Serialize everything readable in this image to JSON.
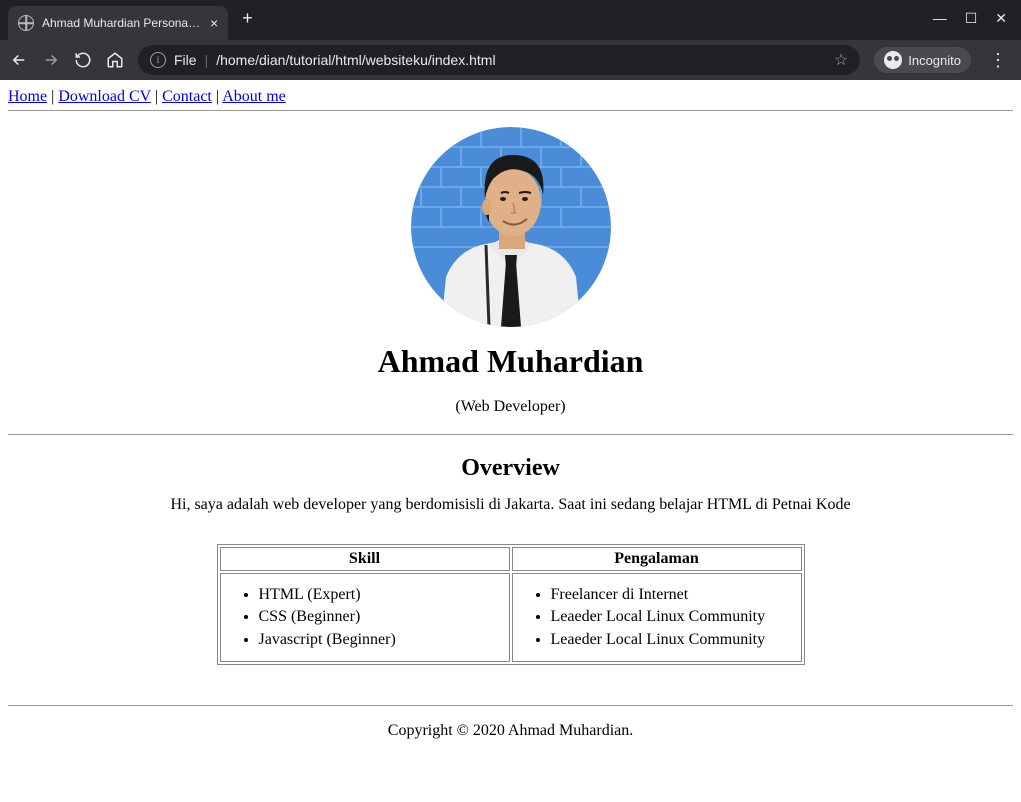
{
  "browser": {
    "tab_title": "Ahmad Muhardian Personal W",
    "url_file_label": "File",
    "url_path": "/home/dian/tutorial/html/websiteku/index.html",
    "incognito_label": "Incognito"
  },
  "nav": {
    "items": [
      "Home",
      "Download CV",
      "Contact",
      "About me"
    ],
    "separator": " | "
  },
  "profile": {
    "name": "Ahmad Muhardian",
    "role": "(Web Developer)"
  },
  "overview": {
    "heading": "Overview",
    "text": "Hi, saya adalah web developer yang berdomisisli di Jakarta. Saat ini sedang belajar HTML di Petnai Kode"
  },
  "table": {
    "headers": [
      "Skill",
      "Pengalaman"
    ],
    "skills": [
      "HTML (Expert)",
      "CSS (Beginner)",
      "Javascript (Beginner)"
    ],
    "experience": [
      "Freelancer di Internet",
      "Leaeder Local Linux Community",
      "Leaeder Local Linux Community"
    ]
  },
  "footer": {
    "text": "Copyright © 2020 Ahmad Muhardian."
  }
}
